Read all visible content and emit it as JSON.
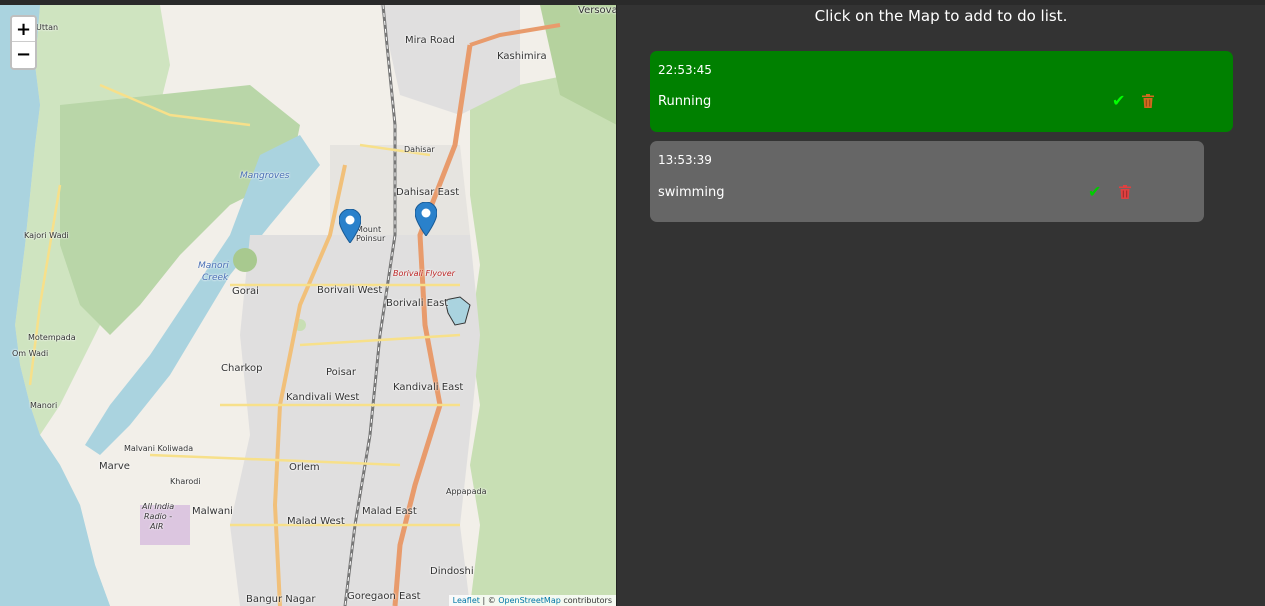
{
  "heading": "Click on the Map to add to do list.",
  "map": {
    "zoom_in_label": "+",
    "zoom_out_label": "−",
    "attribution": {
      "leaflet": "Leaflet",
      "sep": " | © ",
      "osm": "OpenStreetMap",
      "suffix": " contributors"
    },
    "places": {
      "versova": "Versova",
      "mira_road": "Mira Road",
      "kashimira": "Kashimira",
      "uttan": "Uttan",
      "mangroves": "Mangroves",
      "dahisar": "Dahisar",
      "dahisar_east": "Dahisar East",
      "mount_poinsur_1": "Mount",
      "mount_poinsur_2": "Poinsur",
      "kajori_wadi": "Kajori Wadi",
      "manori_creek_1": "Manori",
      "manori_creek_2": "Creek",
      "borivali_flyover": "Borivali Flyover",
      "gorai": "Gorai",
      "borivali_west": "Borivali West",
      "borivali_east": "Borivali East",
      "motempada": "Motempada",
      "om_wadi": "Om Wadi",
      "charkop": "Charkop",
      "poisar": "Poisar",
      "kandivali_east": "Kandivali East",
      "kandivali_west": "Kandivali West",
      "manori": "Manori",
      "malvani_koliwada": "Malvani Koliwada",
      "marve": "Marve",
      "kharodi": "Kharodi",
      "orlem": "Orlem",
      "appapada": "Appapada",
      "malwani": "Malwani",
      "air_1": "All India",
      "air_2": "Radio -",
      "air_3": "AIR",
      "malad_west": "Malad West",
      "malad_east": "Malad East",
      "dindoshi": "Dindoshi",
      "bangur_nagar": "Bangur Nagar",
      "goregaon_east": "Goregaon East"
    },
    "markers": [
      "marker",
      "marker"
    ]
  },
  "todos": [
    {
      "time": "22:53:45",
      "text": "Running",
      "bg": "#008000",
      "check_color": "#00ff00",
      "trash_color": "#d2691e"
    },
    {
      "time": "13:53:39",
      "text": "swimming",
      "bg": "#666666",
      "check_color": "#00cc00",
      "trash_color": "#e04040"
    }
  ],
  "icons": {
    "check": "✔",
    "trash": "trash-icon",
    "marker": "map-marker-icon"
  }
}
